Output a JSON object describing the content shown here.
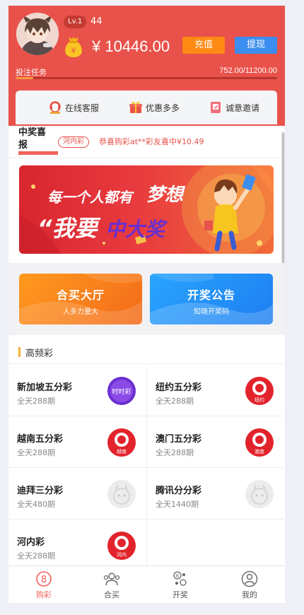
{
  "user": {
    "level": "Lv.1",
    "name": "44",
    "balance": "¥ 10446.00",
    "recharge_label": "充值",
    "withdraw_label": "提现"
  },
  "task": {
    "label": "投注任务",
    "value": "752.00/11200.00",
    "progress": 0.067
  },
  "quick_links": [
    {
      "label": "在线客服",
      "icon": "customer-service-icon"
    },
    {
      "label": "优惠多多",
      "icon": "gift-icon"
    },
    {
      "label": "诚意邀请",
      "icon": "invite-icon"
    }
  ],
  "notice": {
    "title": "中奖喜报",
    "tag": "河内彩",
    "text": "恭喜购彩at**彩友喜中¥10.49"
  },
  "banner": {
    "line1_a": "每一个人都有",
    "line1_b": "梦想",
    "line2_a": "“我要",
    "line2_b": "中大奖"
  },
  "cards": [
    {
      "title": "合买大厅",
      "subtitle": "人多力量大"
    },
    {
      "title": "开奖公告",
      "subtitle": "知晓开奖码"
    }
  ],
  "section": {
    "title": "高频彩"
  },
  "lotteries": [
    {
      "name": "新加坡五分彩",
      "sub": "全天288期",
      "icon": "purple-badge-icon",
      "icon_text": "时时彩"
    },
    {
      "name": "纽约五分彩",
      "sub": "全天288期",
      "icon": "red-ball-icon",
      "icon_text": "纽约"
    },
    {
      "name": "越南五分彩",
      "sub": "全天288期",
      "icon": "red-ball-icon",
      "icon_text": "越南"
    },
    {
      "name": "澳门五分彩",
      "sub": "全天288期",
      "icon": "red-ball-icon",
      "icon_text": "澳度"
    },
    {
      "name": "迪拜三分彩",
      "sub": "全天480期",
      "icon": "placeholder-icon",
      "icon_text": ""
    },
    {
      "name": "腾讯分分彩",
      "sub": "全天1440期",
      "icon": "placeholder-icon",
      "icon_text": ""
    },
    {
      "name": "河内彩",
      "sub": "全天288期",
      "icon": "red-ball-icon",
      "icon_text": "河内"
    }
  ],
  "tabs": [
    {
      "label": "购彩",
      "icon": "lottery-8-icon",
      "active": true
    },
    {
      "label": "合买",
      "icon": "group-buy-icon",
      "active": false
    },
    {
      "label": "开奖",
      "icon": "draw-result-icon",
      "active": false
    },
    {
      "label": "我的",
      "icon": "profile-icon",
      "active": false
    }
  ],
  "colors": {
    "header": "#e8524a",
    "recharge": "#ff8a13",
    "withdraw": "#3b8ef0",
    "accent": "#f2615a"
  }
}
